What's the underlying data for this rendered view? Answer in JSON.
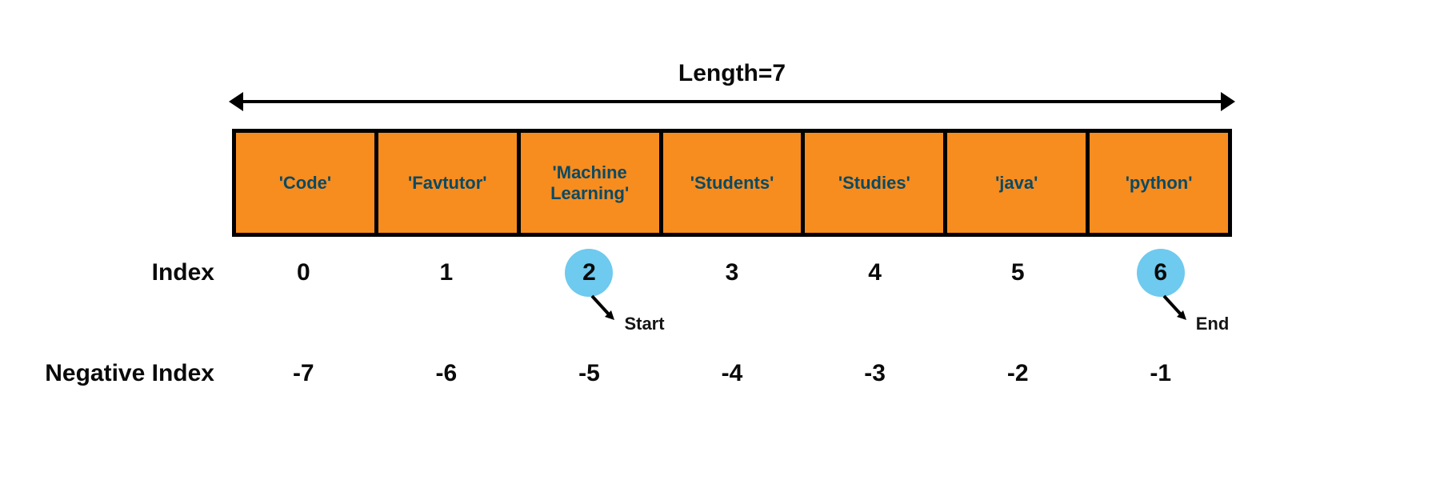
{
  "length_label": "Length=7",
  "cells": [
    "'Code'",
    "'Favtutor'",
    "'Machine Learning'",
    "'Students'",
    "'Studies'",
    "'java'",
    "'python'"
  ],
  "index_label": "Index",
  "indices": [
    "0",
    "1",
    "2",
    "3",
    "4",
    "5",
    "6"
  ],
  "neg_index_label": "Negative Index",
  "neg_indices": [
    "-7",
    "-6",
    "-5",
    "-4",
    "-3",
    "-2",
    "-1"
  ],
  "start_index": 2,
  "end_index": 6,
  "start_label": "Start",
  "end_label": "End",
  "chart_data": {
    "type": "table",
    "title": "Array indexing illustration",
    "length": 7,
    "elements": [
      "Code",
      "Favtutor",
      "Machine Learning",
      "Students",
      "Studies",
      "java",
      "python"
    ],
    "positive_index": [
      0,
      1,
      2,
      3,
      4,
      5,
      6
    ],
    "negative_index": [
      -7,
      -6,
      -5,
      -4,
      -3,
      -2,
      -1
    ],
    "slice_start": 2,
    "slice_end": 6
  }
}
